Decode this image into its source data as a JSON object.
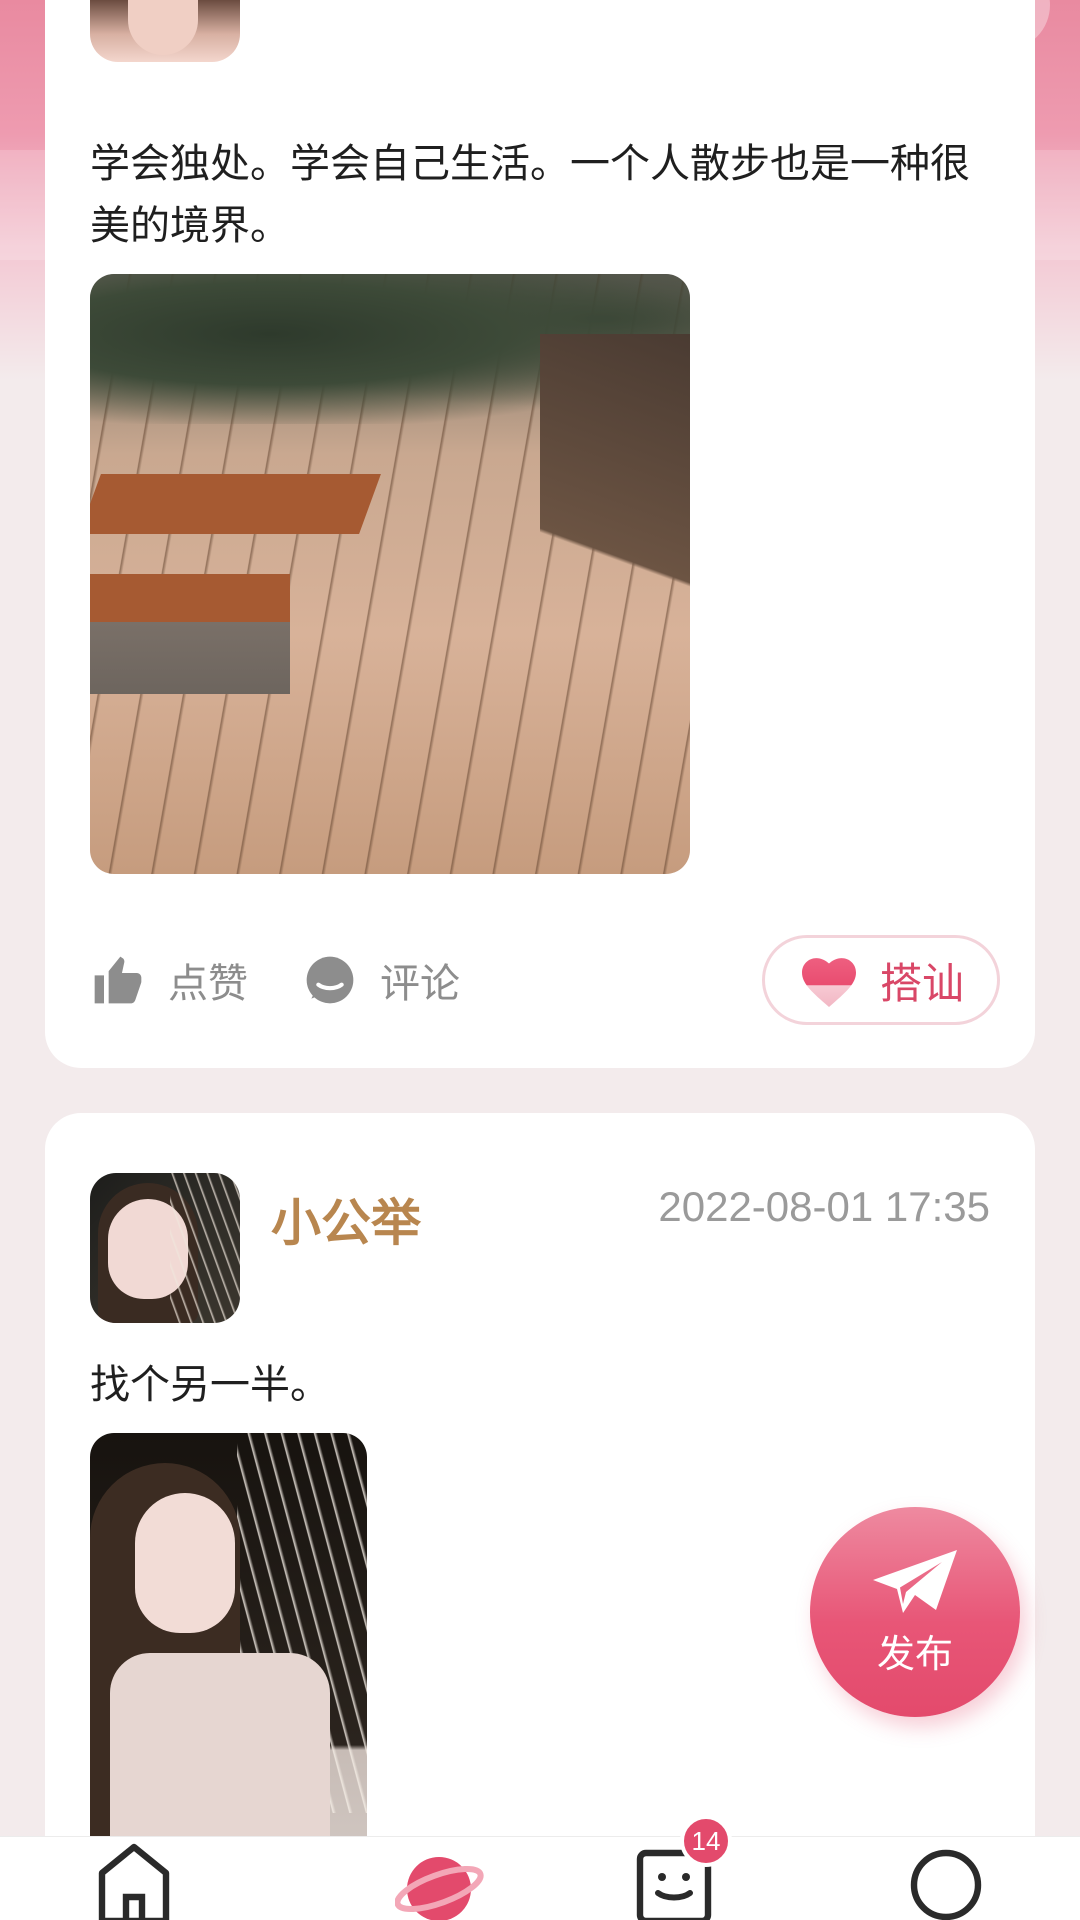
{
  "post1": {
    "text": "学会独处。学会自己生活。一个人散步也是一种很美的境界。",
    "like_label": "点赞",
    "comment_label": "评论",
    "chat_up_label": "搭讪"
  },
  "post2": {
    "username": "小公举",
    "time": "2022-08-01 17:35",
    "text": "找个另一半。"
  },
  "fab": {
    "label": "发布"
  },
  "tabbar": {
    "items": [
      {
        "icon": "home-icon"
      },
      {
        "icon": "planet-icon",
        "active": true
      },
      {
        "icon": "message-icon",
        "badge": "14"
      },
      {
        "icon": "profile-icon"
      }
    ]
  },
  "colors": {
    "accent": "#e34a6c",
    "username": "#b8864f",
    "background": "#f3ebec"
  }
}
